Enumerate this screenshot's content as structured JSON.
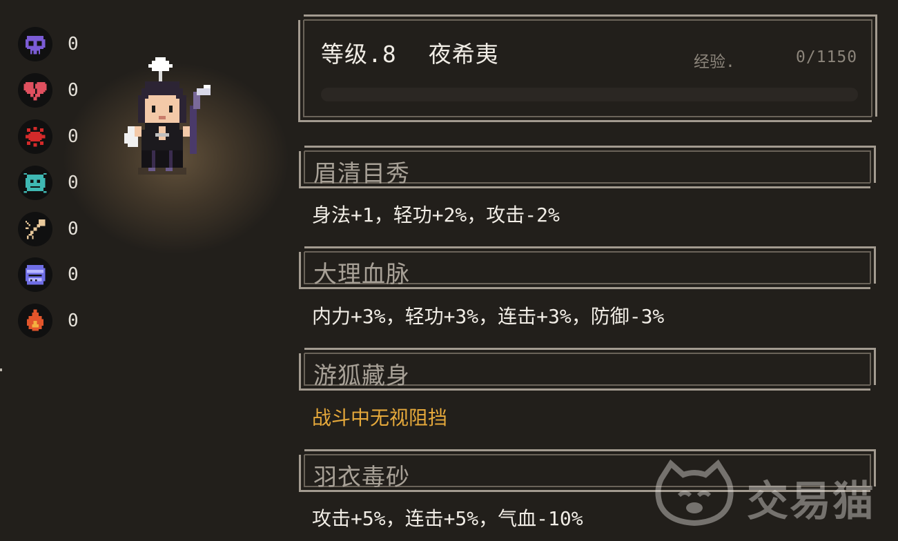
{
  "statuses": [
    {
      "name": "poison-skull",
      "color": "#7b5cd6",
      "value": "0"
    },
    {
      "name": "broken-heart",
      "color": "#e0505f",
      "value": "0"
    },
    {
      "name": "blood-splat",
      "color": "#d42a2a",
      "value": "0"
    },
    {
      "name": "sick-face",
      "color": "#3fb8b3",
      "value": "0"
    },
    {
      "name": "cracked-bone",
      "color": "#e8c89a",
      "value": "0"
    },
    {
      "name": "frozen-face",
      "color": "#6f6ee6",
      "value": "0"
    },
    {
      "name": "flame",
      "color": "#e2552b",
      "value": "0"
    }
  ],
  "character": {
    "level_label": "等级.8",
    "name": "夜希夷",
    "exp_label": "经验.",
    "exp_value": "0/1150",
    "exp_progress": 0
  },
  "traits": [
    {
      "title": "眉清目秀",
      "desc": "身法+1，轻功+2%，攻击-2%",
      "highlight": false
    },
    {
      "title": "大理血脉",
      "desc": "内力+3%，轻功+3%，连击+3%，防御-3%",
      "highlight": false
    },
    {
      "title": "游狐藏身",
      "desc": "战斗中无视阻挡",
      "highlight": true
    },
    {
      "title": "羽衣毒砂",
      "desc": "攻击+5%，连击+5%，气血-10%",
      "highlight": false
    }
  ],
  "watermark": {
    "text": "交易猫"
  },
  "colors": {
    "background": "#221f1b",
    "frame": "#a39b90",
    "gold_text": "#e6a93b"
  }
}
